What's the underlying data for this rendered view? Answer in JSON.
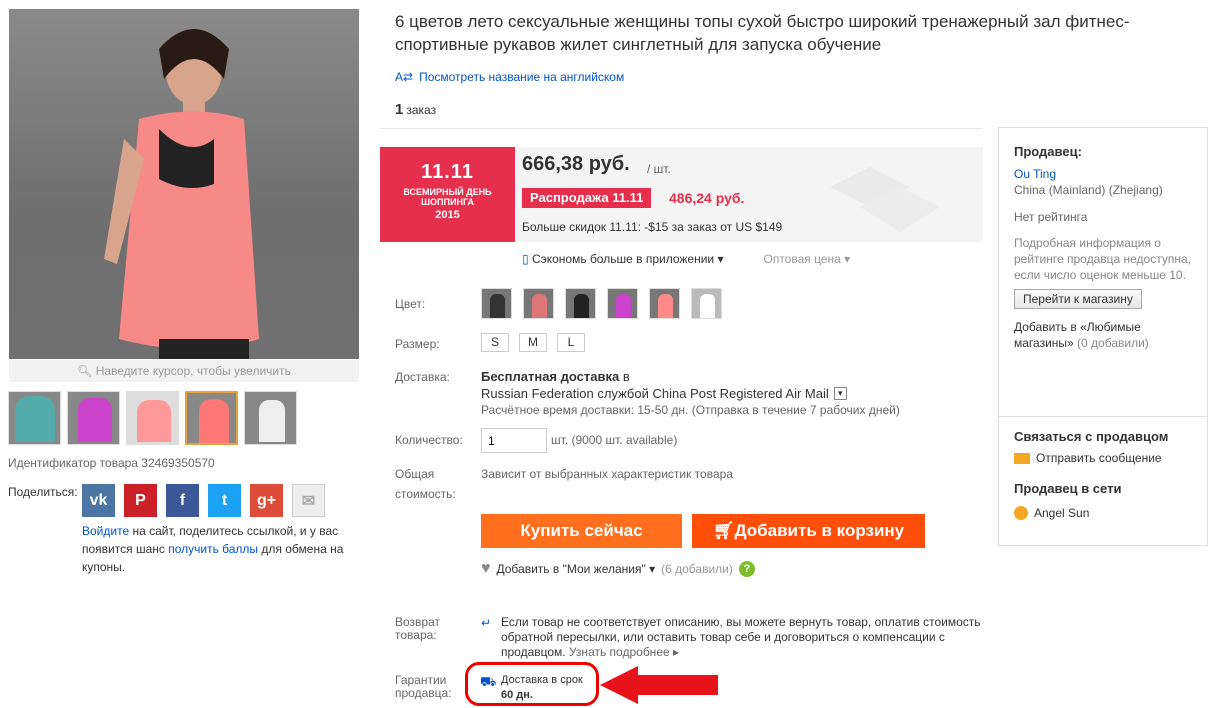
{
  "gallery": {
    "zoom_hint": "Наведите курсор, чтобы увеличить",
    "product_id": "Идентификатор товара 32469350570",
    "thumb_colors": [
      "#5aa",
      "#c4c",
      "#f99",
      "#f77",
      "#eee"
    ]
  },
  "share": {
    "label": "Поделиться:",
    "icons": [
      "vk-icon",
      "pinterest-icon",
      "facebook-icon",
      "twitter-icon",
      "google-plus-icon",
      "email-icon"
    ],
    "note_link1": "Войдите",
    "note_text1": " на сайт, поделитесь ссылкой, и у вас появится шанс ",
    "note_link2": "получить баллы",
    "note_text2": " для обмена на купоны."
  },
  "product": {
    "title": "6 цветов лето сексуальные женщины топы сухой быстро широкий тренажерный зал фитнес-спортивные рукавов жилет синглетный для запуска обучение",
    "translate_link": "Посмотреть название на английском",
    "orders_count": "1",
    "orders_label": "заказ"
  },
  "price": {
    "promo_line1": "11.11",
    "promo_line2": "ВСЕМИРНЫЙ ДЕНЬ",
    "promo_line3": "ШОППИНГА",
    "promo_year": "2015",
    "value": "666,38 руб.",
    "unit": "/ шт.",
    "sale_badge": "Распродажа 11.11",
    "sale_price": "486,24 руб.",
    "discount": "Больше скидок 11.11: -$15 за заказ от US $149",
    "app_save": "Сэкономь больше в приложении",
    "wholesale": "Оптовая цена"
  },
  "props": {
    "color_label": "Цвет:",
    "swatch_colors": [
      "#333",
      "#d77",
      "#222",
      "#c4c",
      "#f88",
      "#fff"
    ],
    "size_label": "Размер:",
    "sizes": [
      "S",
      "M",
      "L"
    ],
    "delivery_label": "Доставка:",
    "delivery_free": "Бесплатная доставка",
    "delivery_in": "в",
    "delivery_route": "Russian Federation службой China Post Registered Air Mail",
    "delivery_time": "Расчётное время доставки: 15-50 дн. (Отправка в течение 7 рабочих дней)",
    "qty_label": "Количество:",
    "qty_value": "1",
    "qty_note": "шт. (9000 шт. available)",
    "total_label1": "Общая",
    "total_label2": "стоимость:",
    "total_value": "Зависит от выбранных характеристик товара"
  },
  "actions": {
    "buy_now": "Купить сейчас",
    "add_cart": "Добавить в корзину",
    "wishlist": "Добавить в \"Мои желания\"",
    "wishlist_count": "(6 добавили)"
  },
  "returns": {
    "label1": "Возврат",
    "label2": "товара:",
    "text": "Если товар не соответствует описанию, вы можете вернуть товар, оплатив стоимость обратной пересылки, или оставить товар себе и договориться о компенсации с продавцом.",
    "more": "Узнать подробнее",
    "guarantee_label1": "Гарантии",
    "guarantee_label2": "продавца:",
    "guarantee_text": "Доставка в срок",
    "guarantee_days": "60 дн."
  },
  "seller": {
    "heading": "Продавец:",
    "name": "Ou Ting",
    "location": "China (Mainland) (Zhejiang)",
    "rating": "Нет рейтинга",
    "rating_note": "Подробная информация о рейтинге продавца недоступна, если число оценок меньше 10.",
    "go_store": "Перейти к магазину",
    "fav_link": "Добавить в «Любимые магазины»",
    "fav_count": " (0 добавили)",
    "contact_heading": "Связаться с продавцом",
    "send_message": "Отправить сообщение",
    "online_heading": "Продавец в сети",
    "online_name": "Angel Sun"
  },
  "colors": {
    "accent_red": "#e62e4d",
    "orange": "#ff6f1e",
    "link": "#05c",
    "annotation": "#e00"
  }
}
